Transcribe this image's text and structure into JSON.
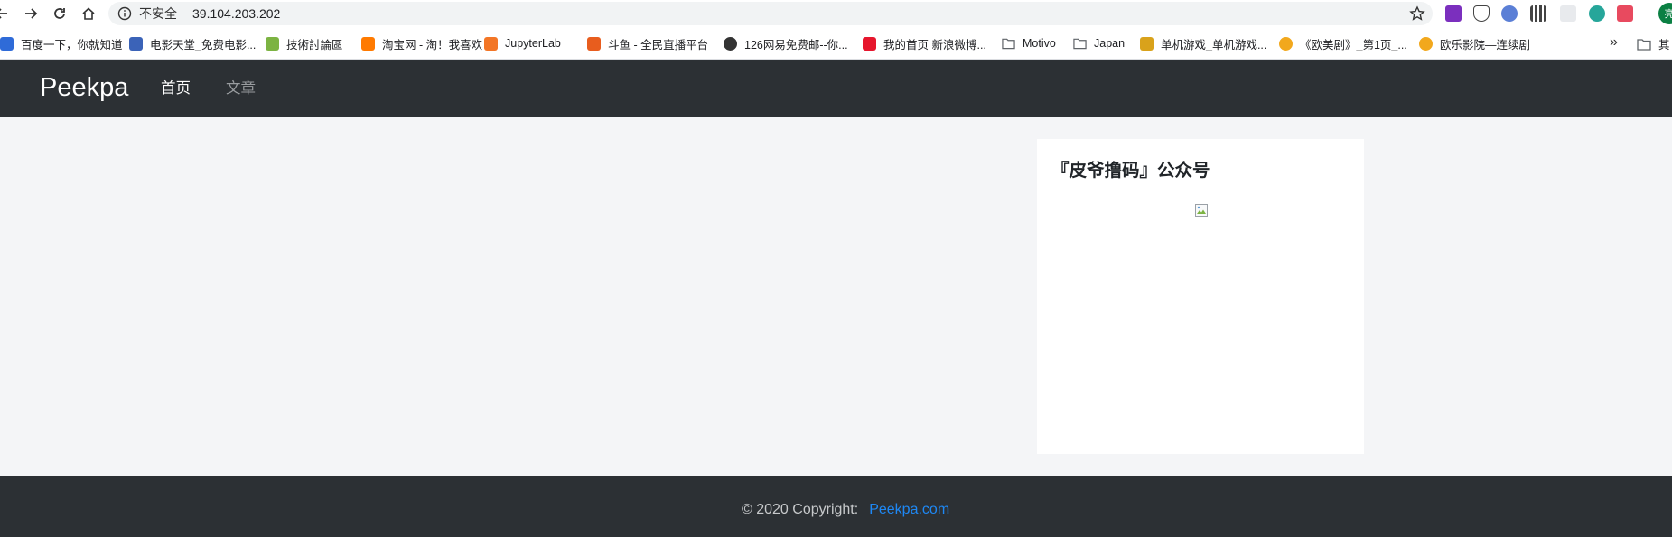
{
  "browser": {
    "address": {
      "status": "不安全",
      "url": "39.104.203.202"
    },
    "avatar_initial": "亮",
    "bookmarks": [
      {
        "label": "百度一下，你就知道",
        "icon": "baidu-icon",
        "color": "#2f6bd8"
      },
      {
        "label": "电影天堂_免费电影...",
        "icon": "grid-icon",
        "color": "#3b63b8"
      },
      {
        "label": "技術討論區",
        "icon": "plant-icon",
        "color": "#7cb342"
      },
      {
        "label": "淘宝网 - 淘！我喜欢",
        "icon": "taobao-icon",
        "color": "#ff7a00"
      },
      {
        "label": "JupyterLab",
        "icon": "jupyter-icon",
        "color": "#f37626"
      },
      {
        "label": "斗鱼 - 全民直播平台",
        "icon": "douyu-icon",
        "color": "#e85d1e"
      },
      {
        "label": "126网易免费邮--你...",
        "icon": "globe-icon",
        "color": "#333333"
      },
      {
        "label": "我的首页 新浪微博...",
        "icon": "weibo-icon",
        "color": "#e6162d"
      },
      {
        "label": "Motivo",
        "icon": "folder-icon",
        "color": "#5f6368"
      },
      {
        "label": "Japan",
        "icon": "folder-icon",
        "color": "#5f6368"
      },
      {
        "label": "单机游戏_单机游戏...",
        "icon": "game-icon",
        "color": "#d9a21b"
      },
      {
        "label": "《欧美剧》_第1页_...",
        "icon": "circle-icon",
        "color": "#f2a81d"
      },
      {
        "label": "欧乐影院—连续剧",
        "icon": "circle-icon",
        "color": "#f2a81d"
      }
    ],
    "bookmarks_more": "»",
    "bookmarks_other": "其"
  },
  "site": {
    "brand": "Peekpa",
    "nav": [
      {
        "label": "首页",
        "active": true
      },
      {
        "label": "文章",
        "active": false
      }
    ]
  },
  "sidebar_card": {
    "title": "『皮爷撸码』公众号"
  },
  "footer": {
    "copyright": "© 2020 Copyright:",
    "link": "Peekpa.com"
  },
  "colors": {
    "nav_bg": "#2c3034",
    "page_bg": "#f4f5f7",
    "link": "#1e88f5"
  }
}
